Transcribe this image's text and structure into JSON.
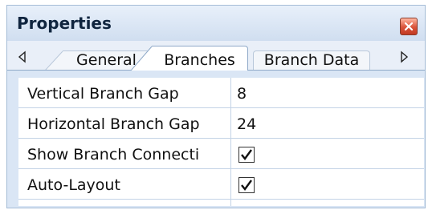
{
  "panel": {
    "title": "Properties",
    "close_icon": "close-icon"
  },
  "tabs": {
    "items": [
      {
        "label": "General",
        "selected": false
      },
      {
        "label": "Branches",
        "selected": true
      },
      {
        "label": "Branch Data",
        "selected": false
      }
    ],
    "scroll_left_icon": "triangle-left-icon",
    "scroll_right_icon": "triangle-right-icon"
  },
  "properties": [
    {
      "name": "Vertical Branch Gap",
      "value": "8",
      "type": "text"
    },
    {
      "name": "Horizontal Branch Gap",
      "value": "24",
      "type": "text"
    },
    {
      "name": "Show Branch Connecti",
      "value": true,
      "type": "checkbox"
    },
    {
      "name": "Auto-Layout",
      "value": true,
      "type": "checkbox"
    }
  ],
  "colors": {
    "panel_background": "#dae6f5",
    "border": "#a4bcd6",
    "grid_line": "#c3d3e6",
    "close_button": "#d9533a"
  }
}
